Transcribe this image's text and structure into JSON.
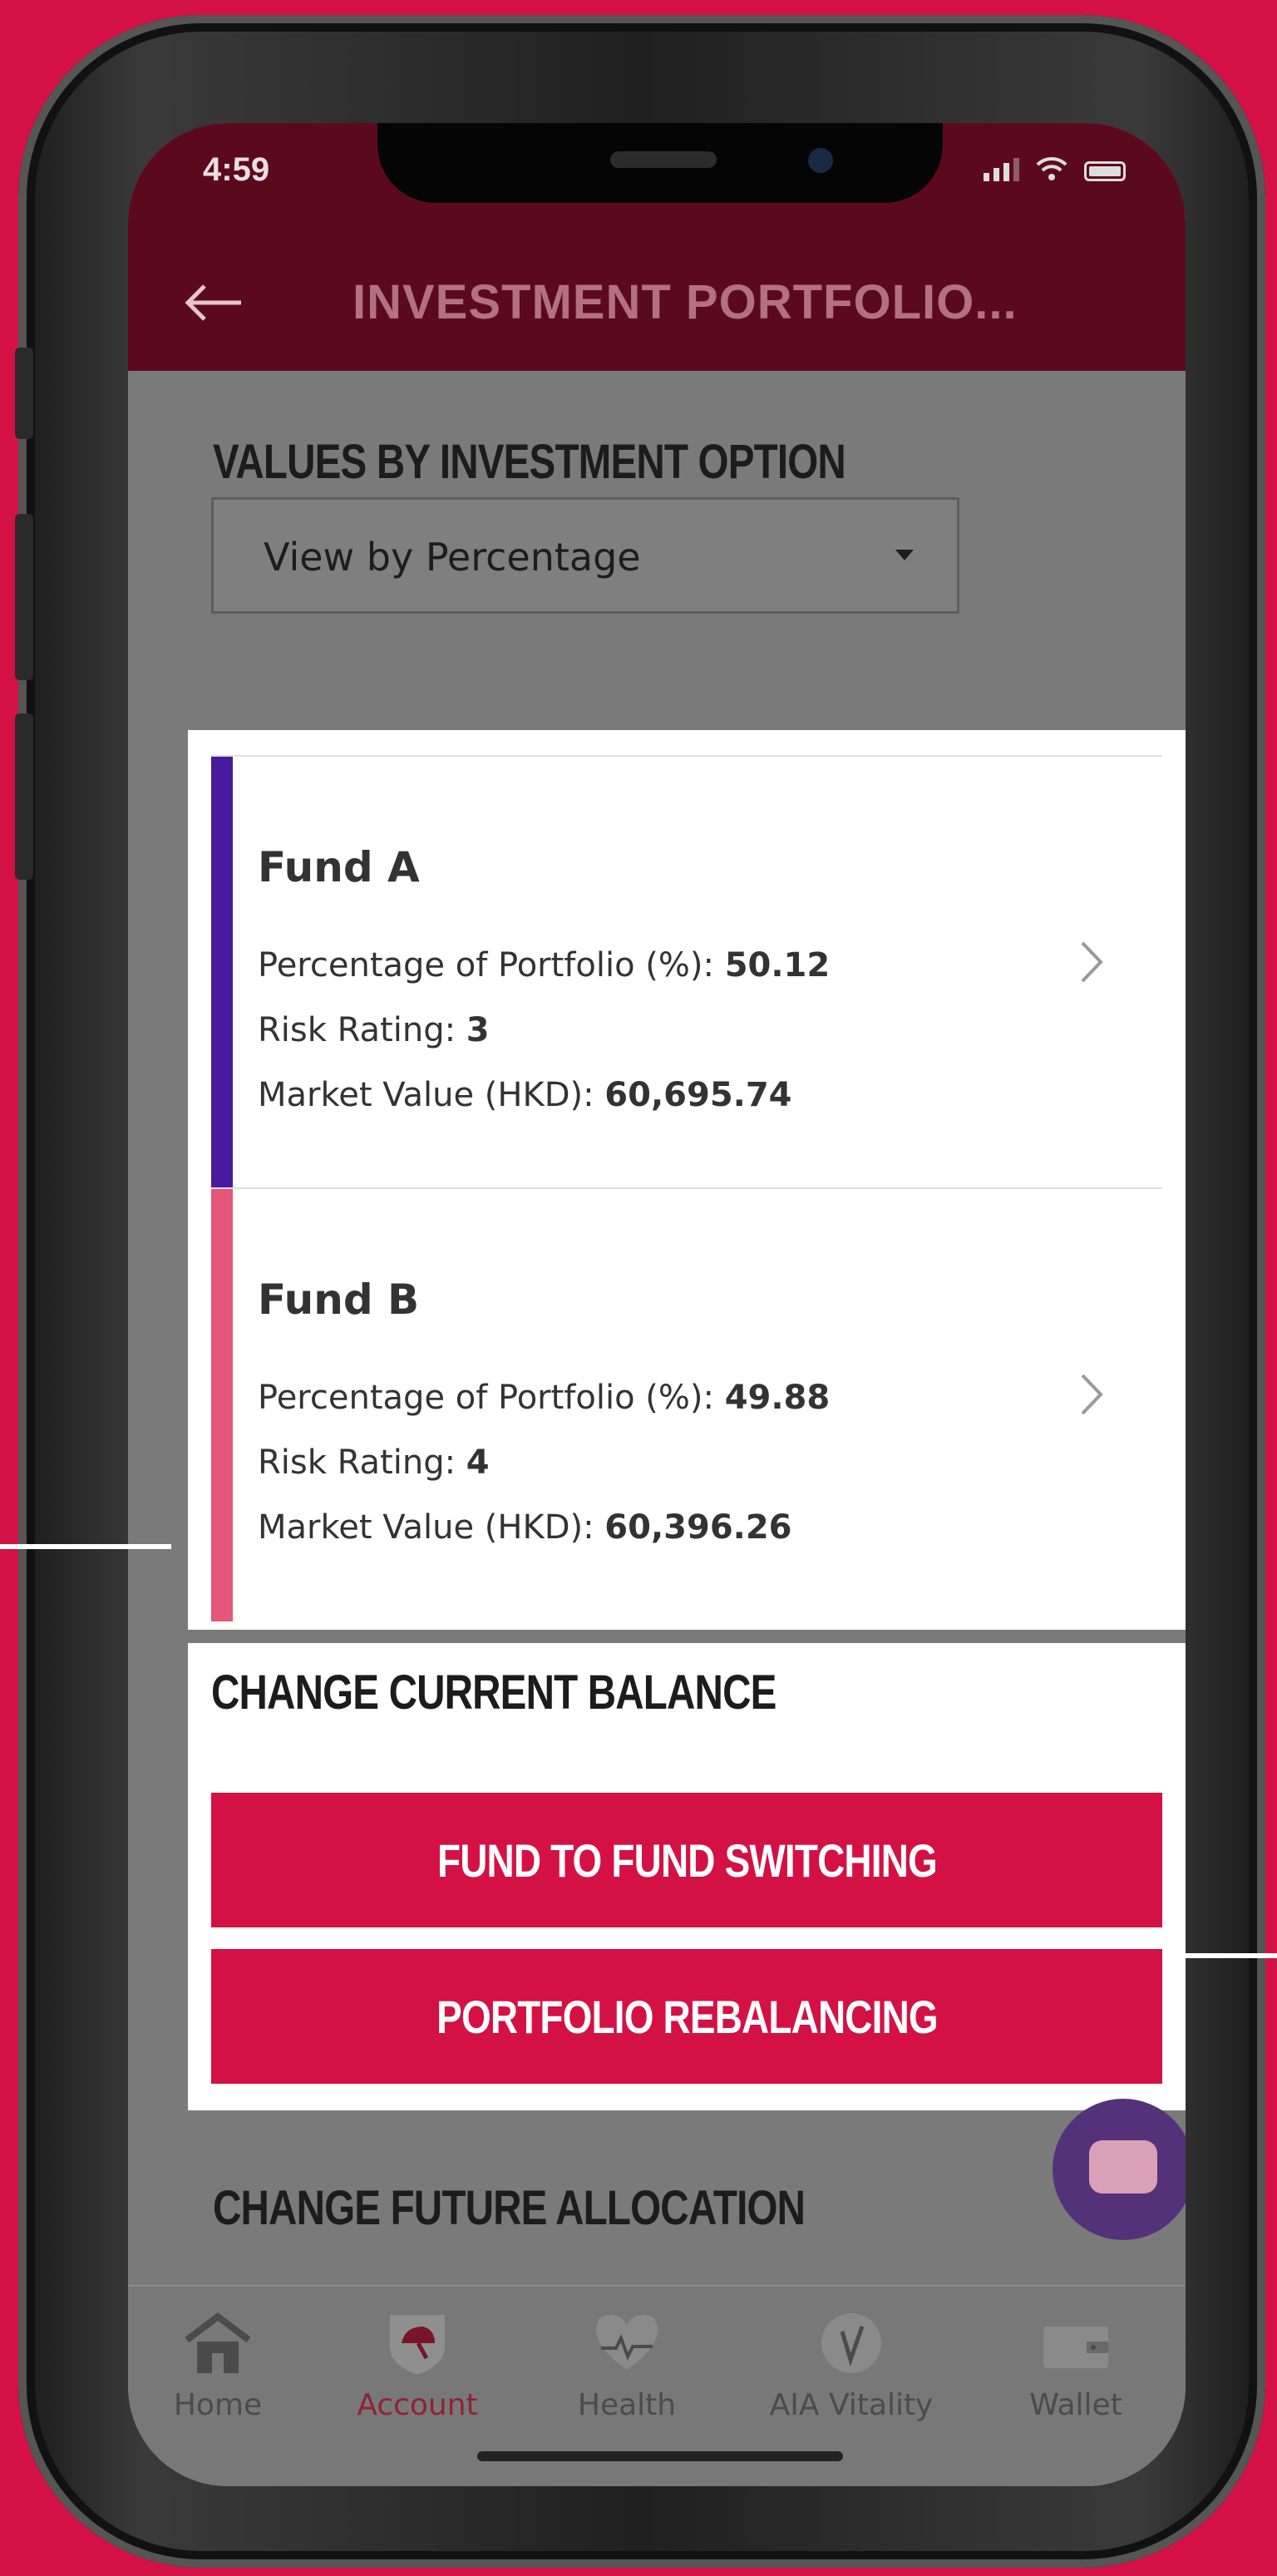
{
  "status_bar": {
    "time": "4:59"
  },
  "header": {
    "title": "INVESTMENT PORTFOLIO..."
  },
  "section_values_title": "VALUES BY INVESTMENT OPTION",
  "view_selector": {
    "selected": "View by Percentage"
  },
  "funds": [
    {
      "name": "Fund A",
      "color": "#4a1a9e",
      "percentage_label": "Percentage of Portfolio (%): ",
      "percentage_value": "50.12",
      "risk_label": "Risk Rating: ",
      "risk_value": "3",
      "market_label": "Market Value (HKD): ",
      "market_value": "60,695.74"
    },
    {
      "name": "Fund B",
      "color": "#e6557a",
      "percentage_label": "Percentage of Portfolio (%): ",
      "percentage_value": "49.88",
      "risk_label": "Risk Rating: ",
      "risk_value": "4",
      "market_label": "Market Value (HKD): ",
      "market_value": "60,396.26"
    }
  ],
  "change_current_balance": {
    "title": "CHANGE CURRENT BALANCE",
    "switch_label": "FUND TO FUND SWITCHING",
    "rebalance_label": "PORTFOLIO REBALANCING"
  },
  "section_future_title": "CHANGE FUTURE ALLOCATION",
  "bottom_nav": [
    {
      "label": "Home",
      "icon": "home-icon"
    },
    {
      "label": "Account",
      "icon": "umbrella-shield-icon"
    },
    {
      "label": "Health",
      "icon": "heartbeat-icon"
    },
    {
      "label": "AIA Vitality",
      "icon": "vitality-check-icon"
    },
    {
      "label": "Wallet",
      "icon": "wallet-icon"
    }
  ],
  "colors": {
    "brand": "#d31145",
    "header": "#5b0a1e",
    "overlay_gray": "#7a7a7a"
  }
}
